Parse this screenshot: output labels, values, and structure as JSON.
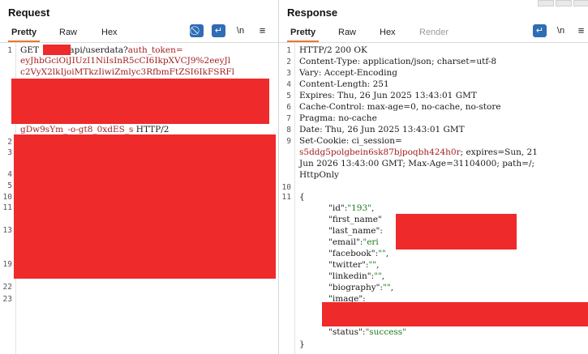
{
  "request": {
    "title": "Request",
    "tabs": [
      "Pretty",
      "Raw",
      "Hex"
    ],
    "newline_label": "\\n",
    "lines": {
      "l1a_method": "GET ",
      "l1a_path": "api/userdata?",
      "l1a_param": "auth_token=",
      "l1b": "eyJhbGciOiJIUzI1NiIsInR5cCI6IkpXVCJ9%2eeyJl",
      "l1c": "c2VyX2lkIjoiMTkzIiwiZmlyc3RfbmFtZSI6IkFSRFl",
      "l1d_token": "gDw9sYm_-o-gt8_0xdES_s",
      "l1d_proto": " HTTP/2"
    },
    "line_numbers": [
      "1",
      "2",
      "3",
      "4",
      "5",
      "10",
      "11",
      "13",
      "19",
      "22",
      "23"
    ]
  },
  "response": {
    "title": "Response",
    "tabs": [
      "Pretty",
      "Raw",
      "Hex",
      "Render"
    ],
    "newline_label": "\\n",
    "lines": {
      "status": "HTTP/2 200 OK",
      "content_type": "Content-Type: application/json; charset=utf-8",
      "vary": "Vary: Accept-Encoding",
      "content_length": "Content-Length: 251",
      "expires": "Expires: Thu, 26 Jun 2025 13:43:01 GMT",
      "cache_control": "Cache-Control: max-age=0, no-cache, no-store",
      "pragma": "Pragma: no-cache",
      "date": "Date: Thu, 26 Jun 2025 13:43:01 GMT",
      "set_cookie_key": "Set-Cookie: ci_session=",
      "set_cookie_value": "s5ddg5polgbein6sk87bjpoqbh424h0r",
      "set_cookie_rest": "; expires=Sun, 21",
      "set_cookie_line2": "Jun 2026 13:43:00 GMT; Max-Age=31104000; path=/;",
      "set_cookie_line3": "HttpOnly",
      "brace_open": "{",
      "brace_close": "}",
      "json": {
        "id_key": "\"id\"",
        "id_val": "\"193\"",
        "first_name_key": "\"first_name\"",
        "last_name_key": "\"last_name\"",
        "email_key": "\"email\"",
        "email_val_partial": "\"eri",
        "facebook_key": "\"facebook\"",
        "facebook_val": "\"\"",
        "twitter_key": "\"twitter\"",
        "twitter_val": "\"\"",
        "linkedin_key": "\"linkedin\"",
        "linkedin_val": "\"\"",
        "biography_key": "\"biography\"",
        "biography_val": "\"\"",
        "image_key": "\"image\"",
        "status_key": "\"status\"",
        "status_val": "\"success\""
      }
    },
    "line_numbers": [
      "1",
      "2",
      "3",
      "4",
      "5",
      "6",
      "7",
      "8",
      "9",
      "10",
      "11"
    ]
  },
  "colors": {
    "accent_tab": "#e8772e",
    "tool_blue": "#2f6db5",
    "redaction": "#ee2a2a",
    "string_red": "#a32020",
    "value_green": "#1f7a1f"
  }
}
